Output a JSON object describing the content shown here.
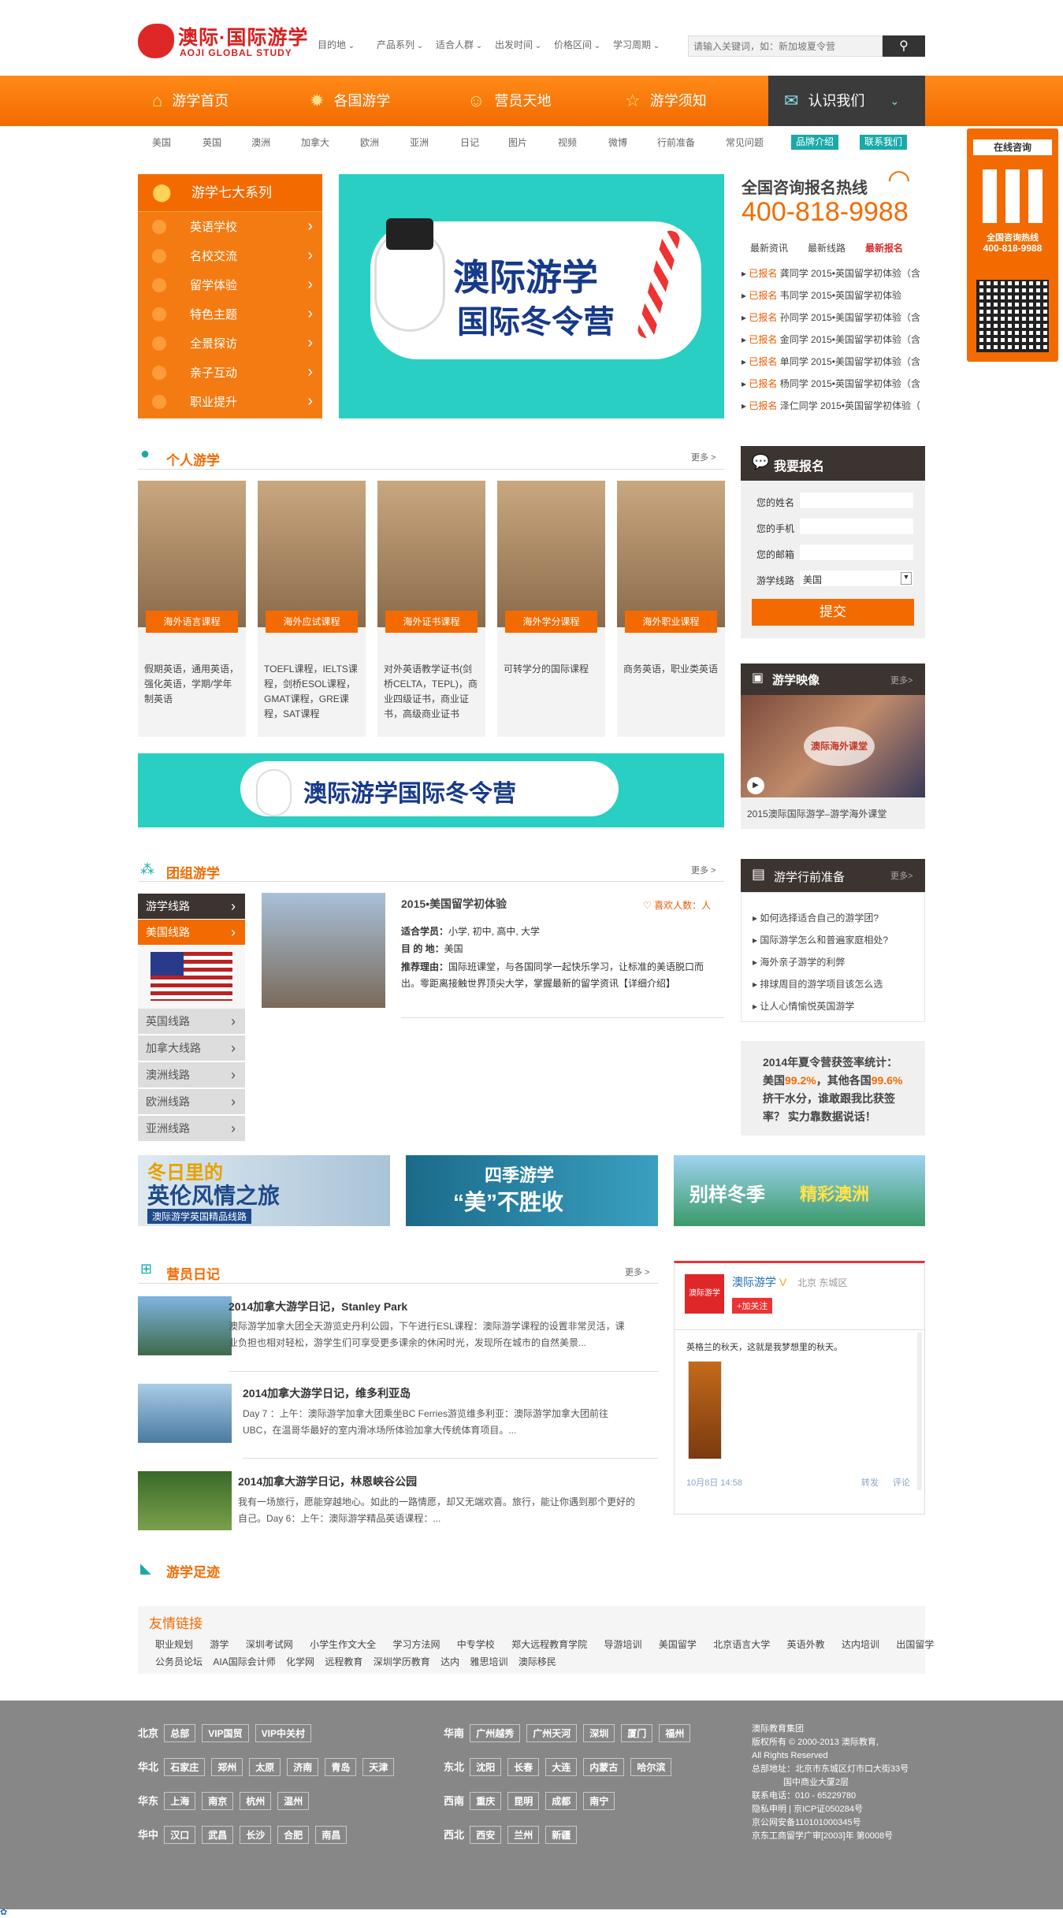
{
  "header": {
    "logo_cn": "澳际·国际游学",
    "logo_en": "AOJI GLOBAL STUDY",
    "menu": [
      "目的地",
      "产品系列",
      "适合人群",
      "出发时间",
      "价格区间",
      "学习周期"
    ],
    "search_placeholder": "请输入关键词，如：新加坡夏令营"
  },
  "nav": [
    {
      "label": "游学首页",
      "icon": "home-icon"
    },
    {
      "label": "各国游学",
      "icon": "gear-icon"
    },
    {
      "label": "营员天地",
      "icon": "person-icon"
    },
    {
      "label": "游学须知",
      "icon": "star-icon"
    },
    {
      "label": "认识我们",
      "icon": "mail-icon"
    }
  ],
  "subnav": [
    "美国",
    "英国",
    "澳洲",
    "加拿大",
    "欧洲",
    "亚洲",
    "日记",
    "图片",
    "视频",
    "微博",
    "行前准备",
    "常见问题"
  ],
  "subnav_chips": [
    "品牌介绍",
    "联系我们"
  ],
  "series": {
    "title": "游学七大系列",
    "items": [
      "英语学校",
      "名校交流",
      "留学体验",
      "特色主题",
      "全景探访",
      "亲子互动",
      "职业提升"
    ]
  },
  "banner": {
    "text1": "澳际游学",
    "text2": "国际冬令营",
    "wide_text": "澳际游学国际冬令营"
  },
  "hotline": {
    "title": "全国咨询报名热线",
    "number": "400-818-9988",
    "tabs": [
      "最新资讯",
      "最新线路",
      "最新报名"
    ],
    "list": [
      {
        "tag": "已报名",
        "text": "龚同学 2015•英国留学初体验（含"
      },
      {
        "tag": "已报名",
        "text": "韦同学 2015•英国留学初体验"
      },
      {
        "tag": "已报名",
        "text": "孙同学 2015•美国留学初体验（含"
      },
      {
        "tag": "已报名",
        "text": "金同学 2015•美国留学初体验（含"
      },
      {
        "tag": "已报名",
        "text": "单同学 2015•美国留学初体验（含"
      },
      {
        "tag": "已报名",
        "text": "杨同学 2015•英国留学初体验（含"
      },
      {
        "tag": "已报名",
        "text": "泽仁同学 2015•英国留学初体验（"
      }
    ]
  },
  "float": {
    "title": "在线咨询",
    "hotline_label": "全国咨询热线",
    "hotline": "400-818-9988"
  },
  "personal": {
    "title": "个人游学",
    "more": "更多 >",
    "cards": [
      {
        "label": "海外语言课程",
        "desc": "假期英语，通用英语，强化英语，学期/学年制英语"
      },
      {
        "label": "海外应试课程",
        "desc": "TOEFL课程，IELTS课程，剑桥ESOL课程，GMAT课程，GRE课程，SAT课程"
      },
      {
        "label": "海外证书课程",
        "desc": "对外英语教学证书(剑桥CELTA，TEPL)，商业四级证书，商业证书，高级商业证书"
      },
      {
        "label": "海外学分课程",
        "desc": "可转学分的国际课程"
      },
      {
        "label": "海外职业课程",
        "desc": "商务英语，职业类英语"
      }
    ]
  },
  "signup": {
    "title": "我要报名",
    "fields": [
      "您的姓名",
      "您的手机",
      "您的邮箱",
      "游学线路"
    ],
    "route_value": "美国",
    "submit": "提交"
  },
  "video": {
    "title": "游学映像",
    "more": "更多>",
    "caption": "2015澳际国际游学–游学海外课堂",
    "overlay": "澳际海外课堂"
  },
  "group": {
    "title": "团组游学",
    "more": "更多 >",
    "menu_head": "游学线路",
    "menu_active": "美国线路",
    "menu": [
      "英国线路",
      "加拿大线路",
      "澳洲线路",
      "欧洲线路",
      "亚洲线路"
    ],
    "item_title": "2015•美国留学初体验",
    "likes_label": "喜欢人数：",
    "likes_value": "人",
    "suit_label": "适合学员：",
    "suit": "小学, 初中, 高中, 大学",
    "dest_label": "目 的 地：",
    "dest": "美国",
    "reason_label": "推荐理由：",
    "reason": "国际班课堂，与各国同学一起快乐学习，让标准的美语脱口而出。零距离接触世界顶尖大学，掌握最新的留学资讯【详细介绍】"
  },
  "prep": {
    "title": "游学行前准备",
    "more": "更多>",
    "items": [
      "如何选择适合自己的游学团?",
      "国际游学怎么和普遍家庭相处?",
      "海外亲子游学的利弊",
      "排球周目的游学项目该怎么选",
      "让人心情愉悦英国游学"
    ]
  },
  "stats": {
    "line1": "2014年夏令营获签率统计：",
    "line2a": "美国",
    "v1": "99.2%",
    "line2b": "，其他各国",
    "v2": "99.6%",
    "line3": "挤干水分，谁敢跟我比获签率？ 实力靠数据说话！"
  },
  "promos": [
    {
      "t1": "冬日里的",
      "t2": "英伦风情之旅",
      "t3": "澳际游学英国精品线路"
    },
    {
      "t1": "四季游学",
      "t2": "“美”不胜收"
    },
    {
      "t1": "别样冬季",
      "t2": "精彩澳洲"
    }
  ],
  "diary": {
    "title": "营员日记",
    "more": "更多 >",
    "items": [
      {
        "title": "2014加拿大游学日记，Stanley Park",
        "desc": "澳际游学加拿大团全天游览史丹利公园，下午进行ESL课程：澳际游学课程的设置非常灵活，课业负担也相对轻松，游学生们可享受更多课余的休闲时光，发现所在城市的自然美景..."
      },
      {
        "title": "2014加拿大游学日记，维多利亚岛",
        "desc": "Day 7 ：上午：澳际游学加拿大团乘坐BC Ferries游览维多利亚：澳际游学加拿大团前往UBC，在温哥华最好的室内滑冰场所体验加拿大传统体育项目。..."
      },
      {
        "title": "2014加拿大游学日记，林恩峡谷公园",
        "desc": "我有一场旅行，愿能穿越地心。如此的一路情愿，却又无端欢喜。旅行，能让你遇到那个更好的自己。Day 6：上午：澳际游学精品英语课程：..."
      }
    ]
  },
  "weibo": {
    "name": "澳际游学",
    "v": "V",
    "loc": "北京 东城区",
    "follow": "+加关注",
    "logo": "澳际游学",
    "post": "英格兰的秋天，这就是我梦想里的秋天。",
    "time": "10月8日 14:58",
    "repost": "转发",
    "comment": "评论"
  },
  "footprint": {
    "title": "游学足迹"
  },
  "friend_links": {
    "title": "友情链接",
    "row1": [
      "职业规划",
      "游学",
      "深圳考试网",
      "小学生作文大全",
      "学习方法网",
      "中专学校",
      "郑大远程教育学院",
      "导游培训",
      "美国留学",
      "北京语言大学",
      "英语外教",
      "达内培训",
      "出国留学"
    ],
    "row2": [
      "公务员论坛",
      "AIA国际会计师",
      "化学网",
      "远程教育",
      "深圳学历教育",
      "达内",
      "雅思培训",
      "澳际移民"
    ]
  },
  "footer": {
    "regions_left": [
      {
        "name": "北京",
        "cities": [
          "总部",
          "VIP国贸",
          "VIP中关村"
        ]
      },
      {
        "name": "华北",
        "cities": [
          "石家庄",
          "郑州",
          "太原",
          "济南",
          "青岛",
          "天津"
        ]
      },
      {
        "name": "华东",
        "cities": [
          "上海",
          "南京",
          "杭州",
          "温州"
        ]
      },
      {
        "name": "华中",
        "cities": [
          "汉口",
          "武昌",
          "长沙",
          "合肥",
          "南昌"
        ]
      }
    ],
    "regions_right": [
      {
        "name": "华南",
        "cities": [
          "广州越秀",
          "广州天河",
          "深圳",
          "厦门",
          "福州"
        ]
      },
      {
        "name": "东北",
        "cities": [
          "沈阳",
          "长春",
          "大连",
          "内蒙古",
          "哈尔滨"
        ]
      },
      {
        "name": "西南",
        "cities": [
          "重庆",
          "昆明",
          "成都",
          "南宁"
        ]
      },
      {
        "name": "西北",
        "cities": [
          "西安",
          "兰州",
          "新疆"
        ]
      }
    ],
    "info": [
      "澳际教育集团",
      "版权所有 © 2000-2013 澳际教育,",
      "All Rights Reserved",
      "总部地址：北京市东城区灯市口大街33号",
      "国中商业大厦2层",
      "联系电话：010 - 65229780",
      "隐私申明 | 京ICP证050284号",
      "京公网安备110101000345号",
      "京东工商留学广审[2003]年 第0008号"
    ]
  },
  "colors": {
    "accent": "#f36b00",
    "dark": "#3b3431",
    "teal": "#29cfc2",
    "footer": "#878787"
  }
}
